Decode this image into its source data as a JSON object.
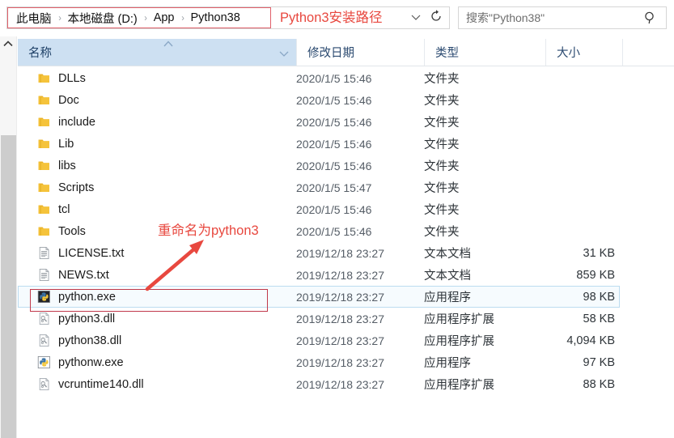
{
  "address_bar": {
    "breadcrumbs": [
      {
        "label": "此电脑"
      },
      {
        "label": "本地磁盘 (D:)"
      },
      {
        "label": "App"
      },
      {
        "label": "Python38"
      }
    ],
    "separator": "›",
    "dropdown_icon": "chevron-down-icon",
    "refresh_icon": "refresh-icon",
    "annotation": "Python3安装路径"
  },
  "search": {
    "placeholder": "搜索\"Python38\"",
    "icon": "search-icon"
  },
  "columns": {
    "name": "名称",
    "date_modified": "修改日期",
    "type": "类型",
    "size": "大小",
    "sort_icon": "sort-ascending-caret-icon",
    "dropdown_icon": "chevron-down-icon"
  },
  "files": [
    {
      "name": "DLLs",
      "icon": "folder-icon",
      "date": "2020/1/5 15:46",
      "type": "文件夹",
      "size": "",
      "selected": false
    },
    {
      "name": "Doc",
      "icon": "folder-icon",
      "date": "2020/1/5 15:46",
      "type": "文件夹",
      "size": "",
      "selected": false
    },
    {
      "name": "include",
      "icon": "folder-icon",
      "date": "2020/1/5 15:46",
      "type": "文件夹",
      "size": "",
      "selected": false
    },
    {
      "name": "Lib",
      "icon": "folder-icon",
      "date": "2020/1/5 15:46",
      "type": "文件夹",
      "size": "",
      "selected": false
    },
    {
      "name": "libs",
      "icon": "folder-icon",
      "date": "2020/1/5 15:46",
      "type": "文件夹",
      "size": "",
      "selected": false
    },
    {
      "name": "Scripts",
      "icon": "folder-icon",
      "date": "2020/1/5 15:47",
      "type": "文件夹",
      "size": "",
      "selected": false
    },
    {
      "name": "tcl",
      "icon": "folder-icon",
      "date": "2020/1/5 15:46",
      "type": "文件夹",
      "size": "",
      "selected": false
    },
    {
      "name": "Tools",
      "icon": "folder-icon",
      "date": "2020/1/5 15:46",
      "type": "文件夹",
      "size": "",
      "selected": false
    },
    {
      "name": "LICENSE.txt",
      "icon": "text-file-icon",
      "date": "2019/12/18 23:27",
      "type": "文本文档",
      "size": "31 KB",
      "selected": false
    },
    {
      "name": "NEWS.txt",
      "icon": "text-file-icon",
      "date": "2019/12/18 23:27",
      "type": "文本文档",
      "size": "859 KB",
      "selected": false
    },
    {
      "name": "python.exe",
      "icon": "python-exe-icon",
      "date": "2019/12/18 23:27",
      "type": "应用程序",
      "size": "98 KB",
      "selected": true
    },
    {
      "name": "python3.dll",
      "icon": "dll-file-icon",
      "date": "2019/12/18 23:27",
      "type": "应用程序扩展",
      "size": "58 KB",
      "selected": false
    },
    {
      "name": "python38.dll",
      "icon": "dll-file-icon",
      "date": "2019/12/18 23:27",
      "type": "应用程序扩展",
      "size": "4,094 KB",
      "selected": false
    },
    {
      "name": "pythonw.exe",
      "icon": "pythonw-exe-icon",
      "date": "2019/12/18 23:27",
      "type": "应用程序",
      "size": "97 KB",
      "selected": false
    },
    {
      "name": "vcruntime140.dll",
      "icon": "dll-file-icon",
      "date": "2019/12/18 23:27",
      "type": "应用程序扩展",
      "size": "88 KB",
      "selected": false
    }
  ],
  "annotations": {
    "rename_note": "重命名为python3",
    "arrow_icon": "red-arrow-icon",
    "box_icon": "red-highlight-box",
    "color": "#e8483f",
    "box_color": "#c0394b"
  },
  "scrollbar": {
    "up_icon": "chevron-up-icon"
  }
}
